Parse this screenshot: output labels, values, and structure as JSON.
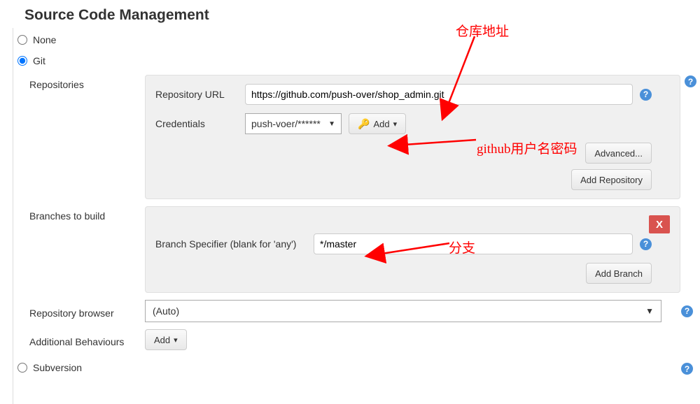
{
  "title": "Source Code Management",
  "scm": {
    "none_label": "None",
    "git_label": "Git",
    "subversion_label": "Subversion",
    "selected": "git"
  },
  "git": {
    "repositories_label": "Repositories",
    "repository_url_label": "Repository URL",
    "repository_url_value": "https://github.com/push-over/shop_admin.git",
    "credentials_label": "Credentials",
    "credentials_selected": "push-voer/******",
    "add_cred_label": "Add",
    "advanced_label": "Advanced...",
    "add_repository_label": "Add Repository",
    "branches_label": "Branches to build",
    "branch_specifier_label": "Branch Specifier (blank for 'any')",
    "branch_specifier_value": "*/master",
    "add_branch_label": "Add Branch",
    "repo_browser_label": "Repository browser",
    "repo_browser_selected": "(Auto)",
    "additional_behaviours_label": "Additional Behaviours",
    "add_behaviour_label": "Add"
  },
  "annotations": {
    "repo_url": "仓库地址",
    "credentials": "github用户名密码",
    "branch": "分支"
  }
}
